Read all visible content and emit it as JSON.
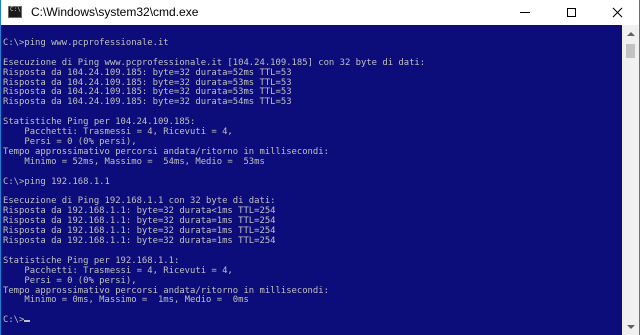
{
  "window": {
    "title": "C:\\Windows\\system32\\cmd.exe",
    "colors": {
      "console_bg": "#0c0c7a",
      "console_fg": "#c0c0c0",
      "border_accent": "#1883d7"
    },
    "icon": "console-app-icon"
  },
  "controls": {
    "minimize_icon": "minimize-icon",
    "maximize_icon": "maximize-icon",
    "close_icon": "close-icon"
  },
  "console": {
    "lines": [
      "",
      "C:\\>ping www.pcprofessionale.it",
      "",
      "Esecuzione di Ping www.pcprofessionale.it [104.24.109.185] con 32 byte di dati:",
      "Risposta da 104.24.109.185: byte=32 durata=52ms TTL=53",
      "Risposta da 104.24.109.185: byte=32 durata=53ms TTL=53",
      "Risposta da 104.24.109.185: byte=32 durata=53ms TTL=53",
      "Risposta da 104.24.109.185: byte=32 durata=54ms TTL=53",
      "",
      "Statistiche Ping per 104.24.109.185:",
      "    Pacchetti: Trasmessi = 4, Ricevuti = 4,",
      "    Persi = 0 (0% persi),",
      "Tempo approssimativo percorsi andata/ritorno in millisecondi:",
      "    Minimo = 52ms, Massimo =  54ms, Medio =  53ms",
      "",
      "C:\\>ping 192.168.1.1",
      "",
      "Esecuzione di Ping 192.168.1.1 con 32 byte di dati:",
      "Risposta da 192.168.1.1: byte=32 durata<1ms TTL=254",
      "Risposta da 192.168.1.1: byte=32 durata=1ms TTL=254",
      "Risposta da 192.168.1.1: byte=32 durata=1ms TTL=254",
      "Risposta da 192.168.1.1: byte=32 durata=1ms TTL=254",
      "",
      "Statistiche Ping per 192.168.1.1:",
      "    Pacchetti: Trasmessi = 4, Ricevuti = 4,",
      "    Persi = 0 (0% persi),",
      "Tempo approssimativo percorsi andata/ritorno in millisecondi:",
      "    Minimo = 0ms, Massimo =  1ms, Medio =  0ms",
      ""
    ],
    "prompt": "C:\\>"
  },
  "scrollbar": {
    "up_icon": "scroll-up-arrow-icon",
    "down_icon": "scroll-down-arrow-icon"
  }
}
